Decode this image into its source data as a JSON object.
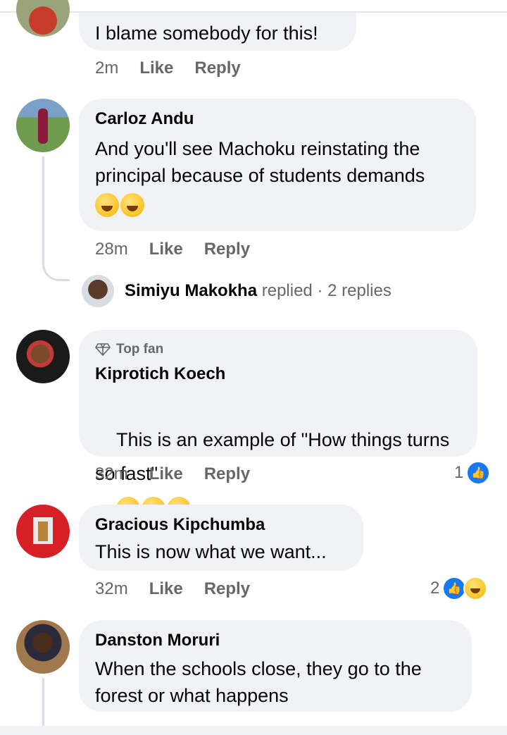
{
  "comments": [
    {
      "text": "I blame somebody for this!",
      "time": "2m",
      "like_label": "Like",
      "reply_label": "Reply"
    },
    {
      "name": "Carloz Andu",
      "text": "And you'll see Machoku reinstating the principal because of students demands",
      "emojis": [
        "rolling-on-floor-laughing-emoji",
        "grinning-sweat-emoji"
      ],
      "time": "28m",
      "like_label": "Like",
      "reply_label": "Reply",
      "replies": {
        "name": "Simiyu Makokha",
        "action": "replied",
        "count": "· 2 replies"
      }
    },
    {
      "badge": "Top fan",
      "name": "Kiprotich Koech",
      "text": "This is an example of \"How things turns so fast\"",
      "time": "32m",
      "like_label": "Like",
      "reply_label": "Reply",
      "reactions": {
        "count": "1",
        "types": [
          "like"
        ]
      }
    },
    {
      "name": "Gracious Kipchumba",
      "text": "This is now what we want...",
      "time": "32m",
      "like_label": "Like",
      "reply_label": "Reply",
      "reactions": {
        "count": "2",
        "types": [
          "like",
          "haha"
        ]
      }
    },
    {
      "name": "Danston Moruri",
      "text": "When the schools close, they go to the forest or what happens"
    }
  ],
  "colors": {
    "like_blue": "#1877f2",
    "bubble_bg": "#f0f2f5",
    "meta_gray": "#65676b"
  }
}
